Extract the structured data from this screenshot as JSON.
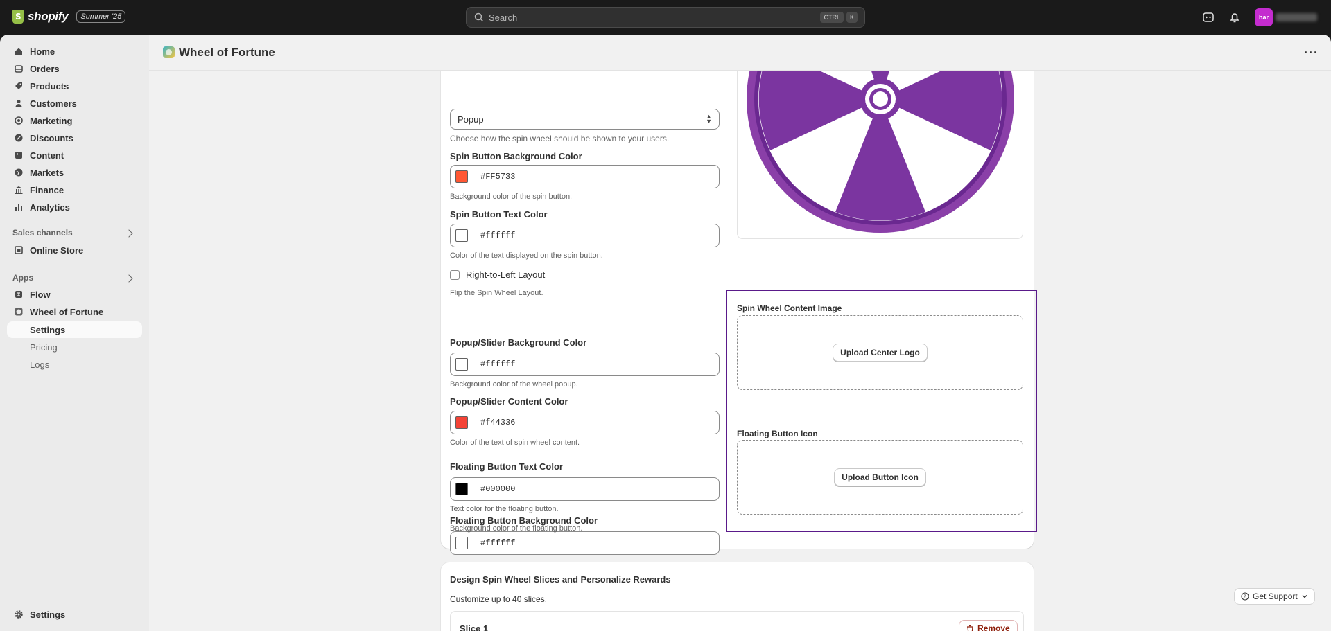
{
  "topbar": {
    "brand": "shopify",
    "edition_badge": "Summer '25",
    "search_placeholder": "Search",
    "shortcut_ctrl": "CTRL",
    "shortcut_key": "K",
    "avatar_initials": "har"
  },
  "sidebar": {
    "items": [
      {
        "label": "Home",
        "icon": "home-icon"
      },
      {
        "label": "Orders",
        "icon": "inbox-icon"
      },
      {
        "label": "Products",
        "icon": "tag-icon"
      },
      {
        "label": "Customers",
        "icon": "person-icon"
      },
      {
        "label": "Marketing",
        "icon": "target-icon"
      },
      {
        "label": "Discounts",
        "icon": "discount-icon"
      },
      {
        "label": "Content",
        "icon": "content-icon"
      },
      {
        "label": "Markets",
        "icon": "globe-icon"
      },
      {
        "label": "Finance",
        "icon": "bank-icon"
      },
      {
        "label": "Analytics",
        "icon": "chart-icon"
      }
    ],
    "sales_channels_title": "Sales channels",
    "online_store": "Online Store",
    "apps_title": "Apps",
    "flow": "Flow",
    "wheel_app": "Wheel of Fortune",
    "sub_settings": "Settings",
    "sub_pricing": "Pricing",
    "sub_logs": "Logs",
    "bottom_settings": "Settings"
  },
  "page": {
    "title": "Wheel of Fortune"
  },
  "form": {
    "display_mode_value": "Popup",
    "display_mode_help": "Choose how the spin wheel should be shown to your users.",
    "spin_bg_label": "Spin Button Background Color",
    "spin_bg_value": "#FF5733",
    "spin_bg_help": "Background color of the spin button.",
    "spin_text_label": "Spin Button Text Color",
    "spin_text_value": "#ffffff",
    "spin_text_help": "Color of the text displayed on the spin button.",
    "rtl_label": "Right-to-Left Layout",
    "rtl_help": "Flip the Spin Wheel Layout.",
    "popup_bg_label": "Popup/Slider Background Color",
    "popup_bg_value": "#ffffff",
    "popup_bg_help": "Background color of the wheel popup.",
    "popup_content_label": "Popup/Slider Content Color",
    "popup_content_value": "#f44336",
    "popup_content_help": "Color of the text of spin wheel content.",
    "float_text_label": "Floating Button Text Color",
    "float_text_value": "#000000",
    "float_text_help": "Text color for the floating button.",
    "float_bg_label": "Floating Button Background Color",
    "float_bg_value": "#ffffff",
    "float_bg_help": "Background color of the floating button.",
    "content_image_label": "Spin Wheel Content Image",
    "upload_logo_btn": "Upload Center Logo",
    "float_icon_label": "Floating Button Icon",
    "upload_icon_btn": "Upload Button Icon"
  },
  "slices": {
    "title": "Design Spin Wheel Slices and Personalize Rewards",
    "subtitle": "Customize up to 40 slices.",
    "slice1_label": "Slice 1",
    "remove_btn": "Remove"
  },
  "support": {
    "label": "Get Support"
  },
  "colors": {
    "wheel_purple": "#7b35a0",
    "wheel_rim": "#8a3fa8",
    "highlight": "#5a1a8a"
  }
}
